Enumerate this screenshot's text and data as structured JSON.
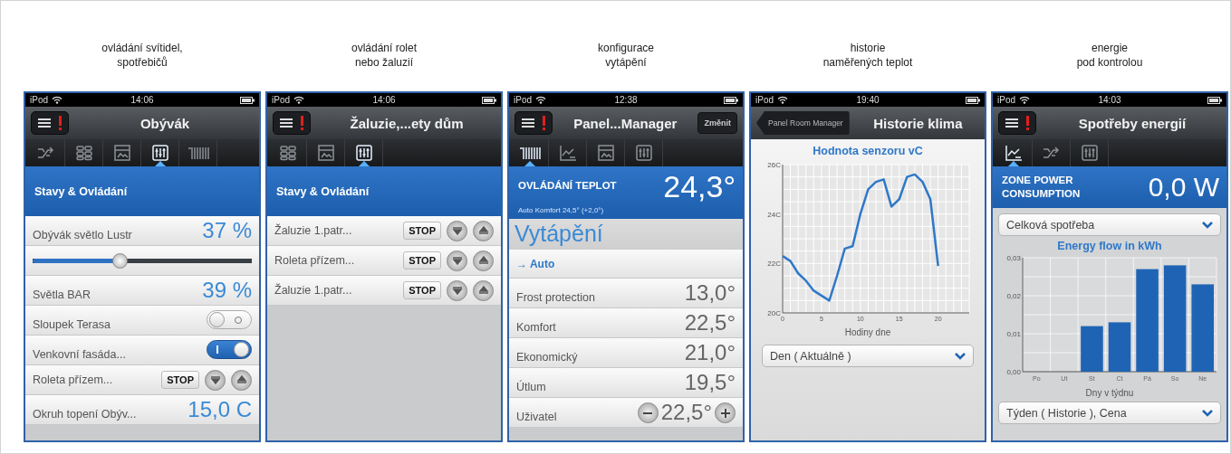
{
  "screens": [
    {
      "caption": "ovládání svítidel,\nspotřebičů",
      "status": {
        "device": "iPod",
        "time": "14:06"
      },
      "header": {
        "kind": "menu",
        "title": "Obývák"
      },
      "tabs": [
        {
          "kind": "flow",
          "selected": false
        },
        {
          "kind": "grid",
          "selected": false
        },
        {
          "kind": "panel",
          "selected": false
        },
        {
          "kind": "sliders",
          "selected": true
        },
        {
          "kind": "heater",
          "selected": false
        }
      ],
      "content": {
        "kind": "controls",
        "section": "Stavy & Ovládání",
        "rows": [
          {
            "kind": "value",
            "label": "Obývák světlo Lustr",
            "value": "37 %"
          },
          {
            "kind": "slider",
            "level": 0.4
          },
          {
            "kind": "value",
            "label": "Světla BAR",
            "value": "39 %"
          },
          {
            "kind": "switch",
            "label": "Sloupek Terasa",
            "on": false
          },
          {
            "kind": "switch",
            "label": "Venkovní fasáda...",
            "on": true
          },
          {
            "kind": "shutter",
            "label": "Roleta přízem...",
            "stop": "STOP"
          },
          {
            "kind": "value",
            "label": "Okruh topení Obýv...",
            "value": "15,0 C"
          }
        ]
      }
    },
    {
      "caption": "ovládání rolet\nnebo žaluzií",
      "status": {
        "device": "iPod",
        "time": "14:06"
      },
      "header": {
        "kind": "menu",
        "title": "Žaluzie,...ety dům"
      },
      "tabs": [
        {
          "kind": "grid",
          "selected": false
        },
        {
          "kind": "panel",
          "selected": false
        },
        {
          "kind": "sliders",
          "selected": true
        }
      ],
      "content": {
        "kind": "controls",
        "section": "Stavy & Ovládání",
        "rows": [
          {
            "kind": "shutter",
            "label": "Žaluzie 1.patr...",
            "stop": "STOP"
          },
          {
            "kind": "shutter",
            "label": "Roleta přízem...",
            "stop": "STOP"
          },
          {
            "kind": "shutter",
            "label": "Žaluzie 1.patr...",
            "stop": "STOP"
          }
        ]
      }
    },
    {
      "caption": "konfigurace\nvytápění",
      "status": {
        "device": "iPod",
        "time": "12:38"
      },
      "header": {
        "kind": "menu",
        "title": "Panel...Manager",
        "action": "Změnit"
      },
      "tabs": [
        {
          "kind": "heater",
          "selected": true
        },
        {
          "kind": "chart",
          "selected": false
        },
        {
          "kind": "panel",
          "selected": false
        },
        {
          "kind": "sliders",
          "selected": false
        }
      ],
      "content": {
        "kind": "heating",
        "band": {
          "label": "OVLÁDÁNÍ TEPLOT",
          "value": "24,3°",
          "sub": "Auto Komfort 24,5° (+2,0°)"
        },
        "heading": "Vytápění",
        "mode": "→ Auto",
        "rows": [
          {
            "kind": "preset",
            "label": "Frost protection",
            "value": "13,0°"
          },
          {
            "kind": "preset",
            "label": "Komfort",
            "value": "22,5°"
          },
          {
            "kind": "preset",
            "label": "Ekonomický",
            "value": "21,0°"
          },
          {
            "kind": "preset",
            "label": "Útlum",
            "value": "19,5°"
          },
          {
            "kind": "stepper",
            "label": "Uživatel",
            "value": "22,5°"
          }
        ]
      }
    },
    {
      "caption": "historie\nnaměřených teplot",
      "status": {
        "device": "iPod",
        "time": "19:40"
      },
      "header": {
        "kind": "back",
        "back": "Panel Room Manager",
        "title": "Historie klima"
      },
      "content": {
        "kind": "history",
        "chart_data": {
          "type": "line",
          "title": "Hodnota senzoru vC",
          "xlabel": "Hodiny dne",
          "x": [
            0,
            1,
            2,
            3,
            4,
            5,
            6,
            7,
            8,
            9,
            10,
            11,
            12,
            13,
            14,
            15,
            16,
            17,
            18,
            19,
            20
          ],
          "grid": true,
          "series": [
            {
              "color": "#2f78c8",
              "values": [
                22.3,
                22.1,
                21.6,
                21.3,
                20.9,
                20.7,
                20.5,
                21.5,
                22.6,
                22.7,
                24.0,
                25.0,
                25.3,
                25.4,
                24.3,
                24.6,
                25.5,
                25.6,
                25.3,
                24.6,
                21.9
              ]
            }
          ],
          "xlim": [
            0,
            24
          ],
          "ylim": [
            20,
            26
          ],
          "xticks": [
            0,
            5,
            10,
            15,
            20
          ],
          "yticks": [
            {
              "value": 20,
              "label": "20C"
            },
            {
              "value": 22,
              "label": "22C"
            },
            {
              "value": 24,
              "label": "24C"
            },
            {
              "value": 26,
              "label": "26C"
            }
          ]
        },
        "select": "Den ( Aktuálně )"
      }
    },
    {
      "caption": "energie\npod kontrolou",
      "status": {
        "device": "iPod",
        "time": "14:03"
      },
      "header": {
        "kind": "menu",
        "title": "Spotřeby energií"
      },
      "tabs": [
        {
          "kind": "chart",
          "selected": true
        },
        {
          "kind": "flow",
          "selected": false
        },
        {
          "kind": "sliders",
          "selected": false
        }
      ],
      "content": {
        "kind": "energy",
        "band": {
          "label": "ZONE POWER CONSUMPTION",
          "value": "0,0 W"
        },
        "select": "Celková spotřeba",
        "chart_data": {
          "type": "bar",
          "title": "Energy flow in kWh",
          "xlabel": "Dny v týdnu",
          "categories": [
            "Po",
            "Ut",
            "St",
            "Ct",
            "Pá",
            "So",
            "Ne"
          ],
          "grid": true,
          "series": [
            {
              "color": "#1f64b4",
              "values": [
                null,
                null,
                0.012,
                0.013,
                0.027,
                0.028,
                0.023
              ]
            }
          ],
          "ylim": [
            0,
            0.03
          ],
          "yticks": [
            {
              "value": 0,
              "label": "0,00"
            },
            {
              "value": 0.01,
              "label": "0,01"
            },
            {
              "value": 0.02,
              "label": "0,02"
            },
            {
              "value": 0.03,
              "label": "0,03"
            }
          ]
        },
        "select2": "Týden ( Historie ), Cena"
      }
    }
  ]
}
